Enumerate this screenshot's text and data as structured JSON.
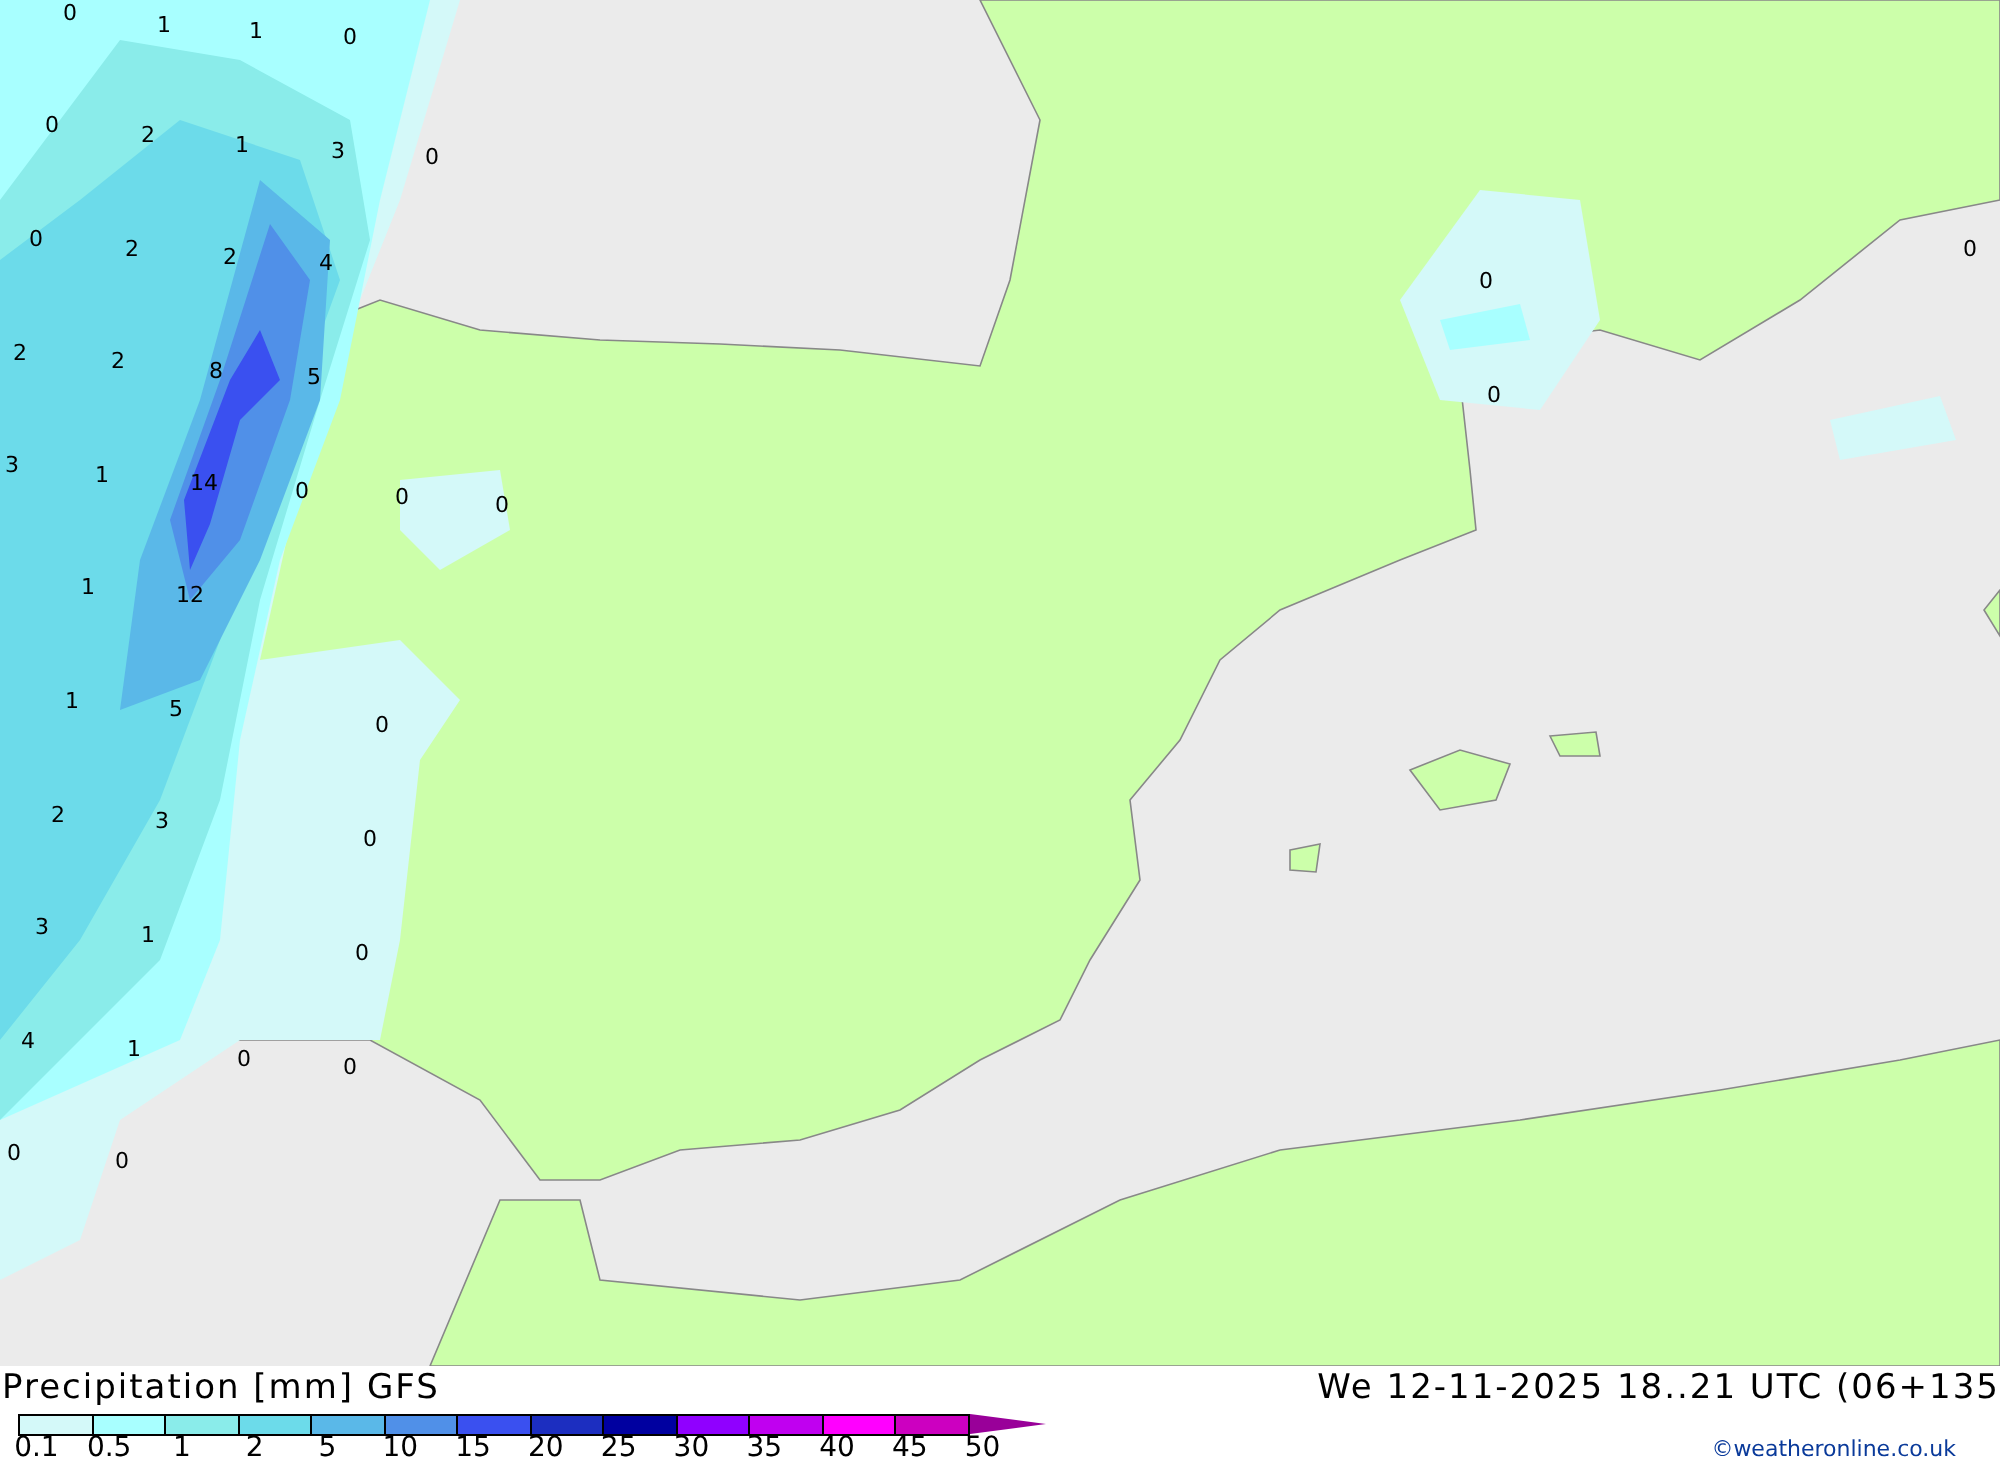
{
  "map": {
    "contour_labels": [
      "0",
      "1",
      "1",
      "0",
      "0",
      "2",
      "1",
      "3",
      "0",
      "0",
      "2",
      "2",
      "4",
      "2",
      "2",
      "8",
      "5",
      "3",
      "1",
      "14",
      "0",
      "0",
      "0",
      "1",
      "12",
      "1",
      "5",
      "0",
      "2",
      "3",
      "0",
      "3",
      "1",
      "0",
      "4",
      "1",
      "0",
      "0",
      "0",
      "0",
      "0",
      "0",
      "0"
    ]
  },
  "title": "Precipitation [mm] GFS",
  "valid_time": "We 12-11-2025 18..21 UTC (06+135",
  "legend": {
    "swatches": [
      {
        "color": "#d4f9f9"
      },
      {
        "color": "#a8ffff"
      },
      {
        "color": "#8aecea"
      },
      {
        "color": "#6cdbea"
      },
      {
        "color": "#5ab8e8"
      },
      {
        "color": "#5090e8"
      },
      {
        "color": "#3a50f0"
      },
      {
        "color": "#1c2ec0"
      },
      {
        "color": "#0000a0"
      },
      {
        "color": "#9000ff"
      },
      {
        "color": "#c000f0"
      },
      {
        "color": "#ff00ff"
      },
      {
        "color": "#cc00c0"
      }
    ],
    "labels": [
      "0.1",
      "0.5",
      "1",
      "2",
      "5",
      "10",
      "15",
      "20",
      "25",
      "30",
      "35",
      "40",
      "45",
      "50"
    ]
  },
  "credit": "©weatheronline.co.uk"
}
